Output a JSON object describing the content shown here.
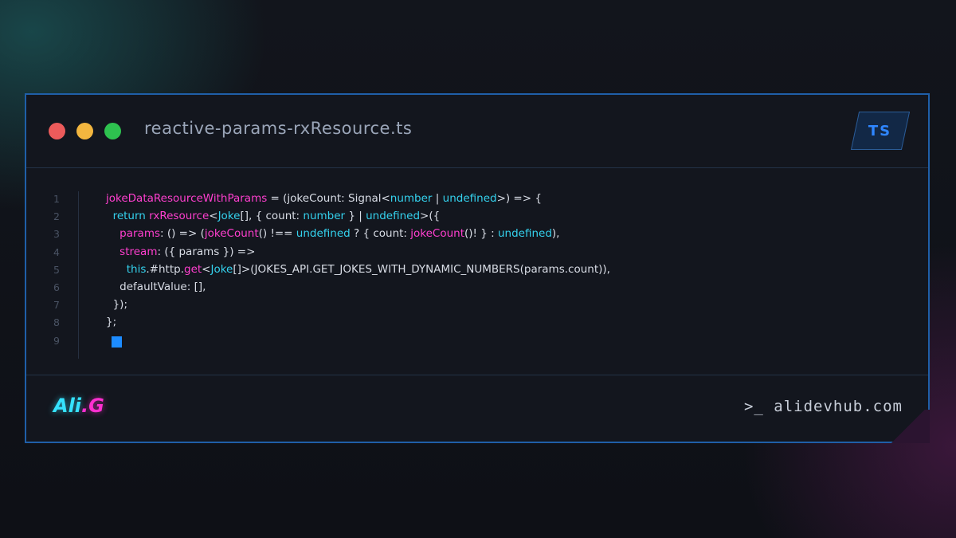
{
  "window": {
    "filename": "reactive-params-rxResource.ts",
    "language_badge": "TS"
  },
  "colors": {
    "border": "#1f5fa8",
    "keyword": "#ff3fcf",
    "type": "#34d2ee",
    "text": "#d9dde6",
    "cursor": "#1d8cff"
  },
  "code": {
    "lines": [
      {
        "n": "1",
        "tokens": [
          {
            "t": "jokeDataResourceWithParams",
            "c": "kw"
          },
          {
            "t": " = (jokeCount: Signal<",
            "c": "pl"
          },
          {
            "t": "number",
            "c": "ty"
          },
          {
            "t": " | ",
            "c": "pl"
          },
          {
            "t": "undefined",
            "c": "ty"
          },
          {
            "t": ">) => {",
            "c": "pl"
          }
        ]
      },
      {
        "n": "2",
        "tokens": [
          {
            "t": "  return ",
            "c": "ty"
          },
          {
            "t": "rxResource",
            "c": "kw"
          },
          {
            "t": "<",
            "c": "pl"
          },
          {
            "t": "Joke",
            "c": "ty"
          },
          {
            "t": "[], { count: ",
            "c": "pl"
          },
          {
            "t": "number",
            "c": "ty"
          },
          {
            "t": " } | ",
            "c": "pl"
          },
          {
            "t": "undefined",
            "c": "ty"
          },
          {
            "t": ">({",
            "c": "pl"
          }
        ]
      },
      {
        "n": "3",
        "tokens": [
          {
            "t": "    params",
            "c": "kw"
          },
          {
            "t": ": () => (",
            "c": "pl"
          },
          {
            "t": "jokeCount",
            "c": "kw"
          },
          {
            "t": "() !== ",
            "c": "pl"
          },
          {
            "t": "undefined",
            "c": "ty"
          },
          {
            "t": " ? { count: ",
            "c": "pl"
          },
          {
            "t": "jokeCount",
            "c": "kw"
          },
          {
            "t": "()! } : ",
            "c": "pl"
          },
          {
            "t": "undefined",
            "c": "ty"
          },
          {
            "t": "),",
            "c": "pl"
          }
        ]
      },
      {
        "n": "4",
        "tokens": [
          {
            "t": "    stream",
            "c": "kw"
          },
          {
            "t": ": ({ params }) =>",
            "c": "pl"
          }
        ]
      },
      {
        "n": "5",
        "tokens": [
          {
            "t": "      this",
            "c": "ty"
          },
          {
            "t": ".#http.",
            "c": "pl"
          },
          {
            "t": "get",
            "c": "kw"
          },
          {
            "t": "<",
            "c": "pl"
          },
          {
            "t": "Joke",
            "c": "ty"
          },
          {
            "t": "[]>(JOKES_API.GET_JOKES_WITH_DYNAMIC_NUMBERS(params.count)),",
            "c": "pl"
          }
        ]
      },
      {
        "n": "6",
        "tokens": [
          {
            "t": "    defaultValue: [],",
            "c": "pl"
          }
        ]
      },
      {
        "n": "7",
        "tokens": [
          {
            "t": "  });",
            "c": "pl"
          }
        ]
      },
      {
        "n": "8",
        "tokens": [
          {
            "t": "};",
            "c": "pl"
          }
        ]
      },
      {
        "n": "9",
        "tokens": []
      }
    ]
  },
  "footer": {
    "logo_part1": "Ali",
    "logo_part2": ".G",
    "site": ">_ alidevhub.com"
  }
}
